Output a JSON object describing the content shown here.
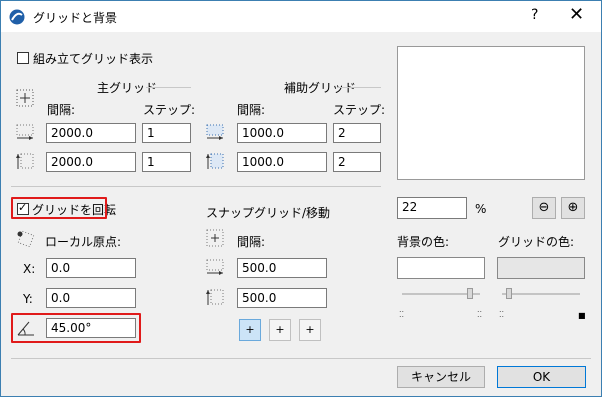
{
  "window": {
    "title": "グリッドと背景",
    "help": "?",
    "close": "✕"
  },
  "construction_grid": {
    "label": "組み立てグリッド表示",
    "checked": false
  },
  "main_grid": {
    "header": "主グリッド",
    "spacing_label": "間隔:",
    "step_label": "ステップ:",
    "x_spacing": "2000.0",
    "x_step": "1",
    "y_spacing": "2000.0",
    "y_step": "1"
  },
  "aux_grid": {
    "header": "補助グリッド",
    "spacing_label": "間隔:",
    "step_label": "ステップ:",
    "x_spacing": "1000.0",
    "x_step": "2",
    "y_spacing": "1000.0",
    "y_step": "2"
  },
  "rotate_grid": {
    "label": "グリッドを回転",
    "checked": true
  },
  "local_origin": {
    "label": "ローカル原点:",
    "x_label": "X:",
    "x_value": "0.0",
    "y_label": "Y:",
    "y_value": "0.0",
    "angle_value": "45.00°"
  },
  "snap_grid": {
    "header": "スナップグリッド/移動",
    "spacing_label": "間隔:",
    "x_value": "500.0",
    "y_value": "500.0"
  },
  "zoom": {
    "value": "22",
    "unit": "%",
    "zoom_out": "⊖",
    "zoom_in": "⊕"
  },
  "colors": {
    "background_label": "背景の色:",
    "grid_label": "グリッドの色:",
    "background_color": "#ffffff",
    "grid_color": "#e6e6e6",
    "background_slider": 0.9,
    "grid_slider": 0.05
  },
  "buttons": {
    "cancel": "キャンセル",
    "ok": "OK"
  },
  "highlight_color": "#e01a1a"
}
